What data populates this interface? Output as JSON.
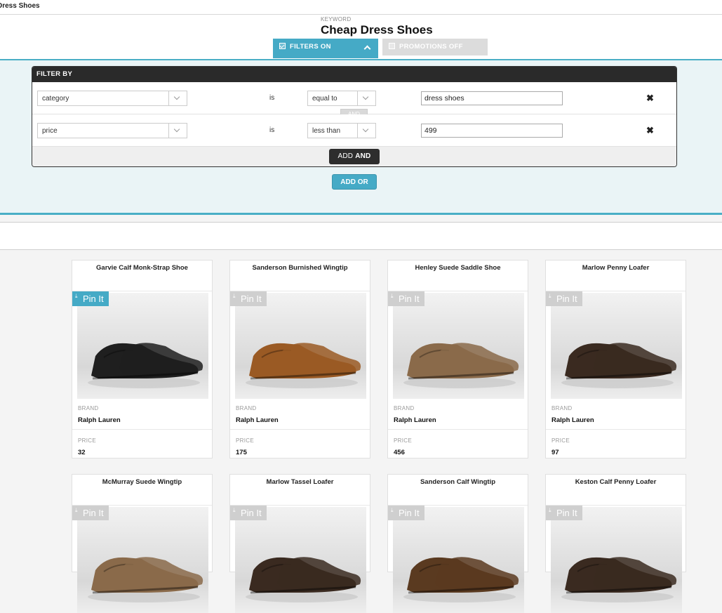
{
  "window": {
    "title": "Dress Shoes"
  },
  "header": {
    "keyword_label": "KEYWORD",
    "keyword": "Cheap Dress Shoes",
    "tabs": [
      {
        "label": "FILTERS ON",
        "state": "on"
      },
      {
        "label": "PROMOTIONS OFF",
        "state": "off"
      }
    ]
  },
  "filter": {
    "title": "FILTER BY",
    "rows": [
      {
        "field": "category",
        "is": "is",
        "operator": "equal to",
        "value": "dress shoes"
      },
      {
        "field": "price",
        "is": "is",
        "operator": "less than",
        "value": "499"
      }
    ],
    "and_badge": "AND",
    "add_and_prefix": "ADD",
    "add_and_suffix": "AND",
    "add_or": "ADD OR"
  },
  "products": {
    "brand_label": "BRAND",
    "price_label": "PRICE",
    "pin_label": "Pin It",
    "items": [
      {
        "name": "Garvie Calf Monk-Strap Shoe",
        "brand": "Ralph Lauren",
        "price": "32",
        "pin_active": true,
        "shoe_color": "#1f1f1f"
      },
      {
        "name": "Sanderson Burnished Wingtip",
        "brand": "Ralph Lauren",
        "price": "175",
        "pin_active": false,
        "shoe_color": "#9a5a24"
      },
      {
        "name": "Henley Suede Saddle Shoe",
        "brand": "Ralph Lauren",
        "price": "456",
        "pin_active": false,
        "shoe_color": "#8a6a4a"
      },
      {
        "name": "Marlow Penny Loafer",
        "brand": "Ralph Lauren",
        "price": "97",
        "pin_active": false,
        "shoe_color": "#3a2a20"
      },
      {
        "name": "McMurray Suede Wingtip",
        "brand": "",
        "price": "",
        "pin_active": false,
        "shoe_color": "#8a6a4a"
      },
      {
        "name": "Marlow Tassel Loafer",
        "brand": "",
        "price": "",
        "pin_active": false,
        "shoe_color": "#3a2a20"
      },
      {
        "name": "Sanderson Calf Wingtip",
        "brand": "",
        "price": "",
        "pin_active": false,
        "shoe_color": "#5a3a20"
      },
      {
        "name": "Keston Calf Penny Loafer",
        "brand": "",
        "price": "",
        "pin_active": false,
        "shoe_color": "#3a2a20"
      }
    ]
  },
  "colors": {
    "accent": "#45aac6",
    "dark": "#2a2a2a"
  }
}
